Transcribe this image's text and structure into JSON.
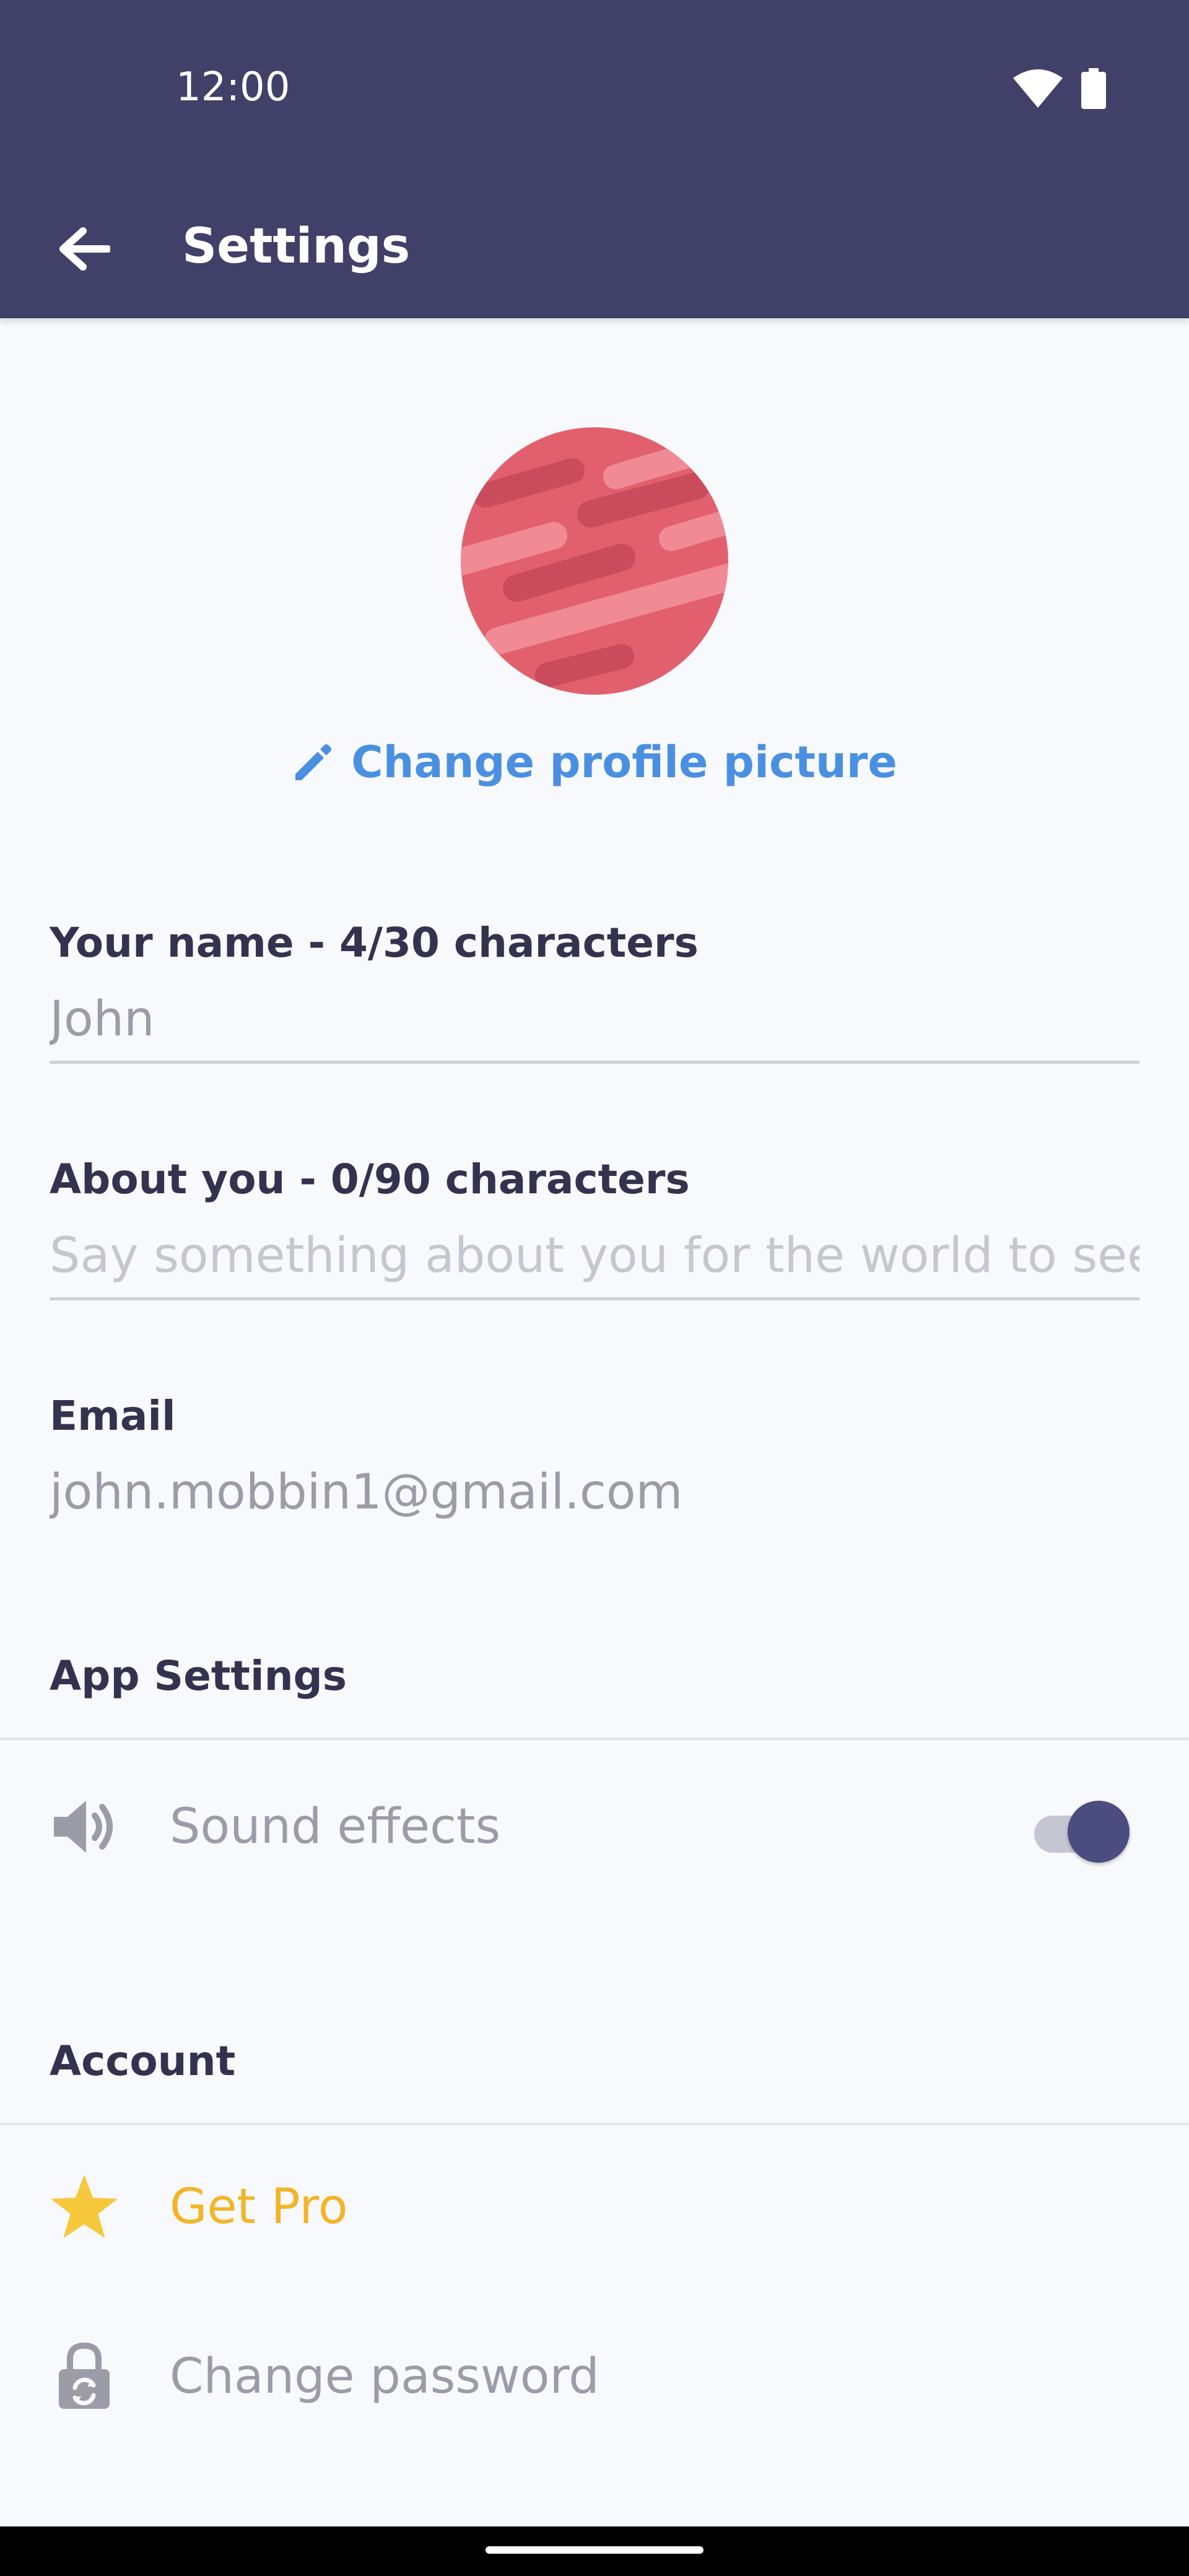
{
  "status": {
    "time": "12:00"
  },
  "appbar": {
    "title": "Settings"
  },
  "profile": {
    "change_label": "Change profile picture"
  },
  "fields": {
    "name": {
      "label": "Your name - 4/30 characters",
      "value": "John"
    },
    "about": {
      "label": "About you - 0/90 characters",
      "placeholder": "Say something about you for the world to see"
    },
    "email": {
      "label": "Email",
      "value": "john.mobbin1@gmail.com"
    }
  },
  "app_settings": {
    "title": "App Settings",
    "sound": {
      "label": "Sound effects",
      "enabled": true
    }
  },
  "account": {
    "title": "Account",
    "items": [
      {
        "label": "Get Pro",
        "icon": "star-icon"
      },
      {
        "label": "Change password",
        "icon": "lock-icon"
      }
    ]
  },
  "colors": {
    "appbar": "#404068",
    "link": "#4a90e2",
    "pro": "#f4b428",
    "toggle_thumb": "#4b4c80"
  }
}
